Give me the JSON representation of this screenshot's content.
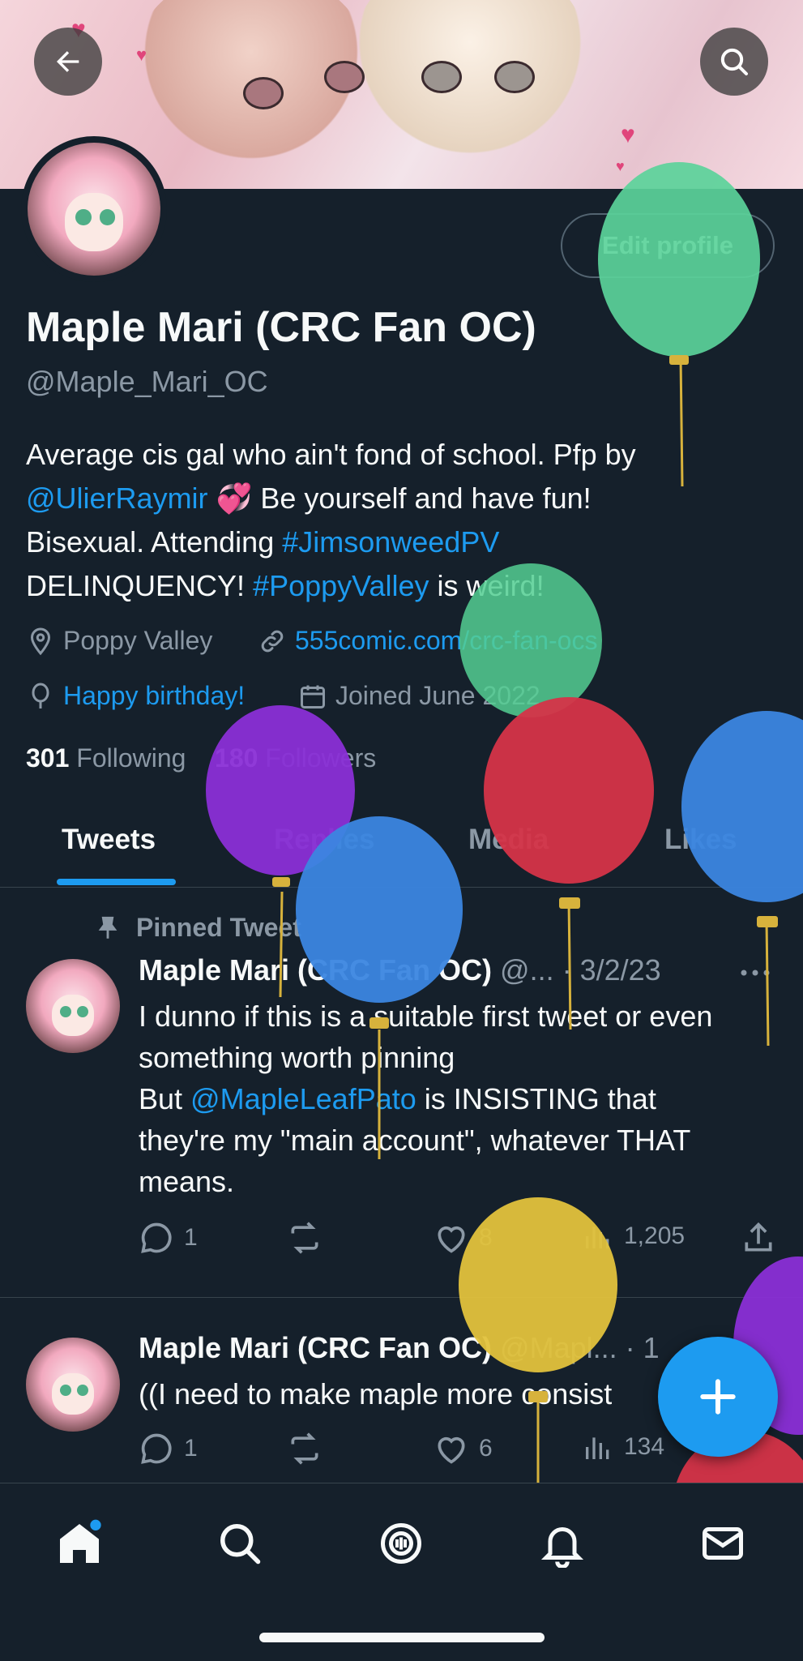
{
  "header": {
    "back_icon": "arrow-left-icon",
    "search_icon": "search-icon"
  },
  "profile": {
    "edit_label": "Edit profile",
    "name": "Maple Mari (CRC Fan OC)",
    "handle": "@Maple_Mari_OC",
    "bio": {
      "line1": "Average cis gal who ain't fond of school. Pfp by",
      "mention": "@UlierRaymir",
      "emoji": "💞",
      "line2_rest": " Be yourself and have fun!",
      "line3_pre": "Bisexual. Attending ",
      "hashtag1": "#JimsonweedPV",
      "line4_pre": "DELINQUENCY! ",
      "hashtag2": "#PoppyValley",
      "line4_post": " is weird!"
    },
    "location": "Poppy Valley",
    "website": "555comic.com/crc-fan-ocs",
    "birthday": "Happy birthday!",
    "joined": "Joined June 2022",
    "following_count": "301",
    "following_label": "Following",
    "followers_count": "180",
    "followers_label": "Followers"
  },
  "tabs": [
    "Tweets",
    "Replies",
    "Media",
    "Likes"
  ],
  "tweets": [
    {
      "pinned_label": "Pinned Tweet",
      "name": "Maple Mari (CRC Fan OC)",
      "handle": "@...",
      "date": "· 3/2/23",
      "text_line1": "I dunno if this is a suitable first tweet or even",
      "text_line2": "something worth pinning",
      "text_line3_pre": "But ",
      "text_mention": "@MapleLeafPato",
      "text_line3_post": " is INSISTING that",
      "text_line4": "they're my \"main account\", whatever THAT",
      "text_line5": "means.",
      "replies": "1",
      "retweets": "",
      "likes": "8",
      "views": "1,205"
    },
    {
      "name": "Maple Mari (CRC Fan OC)",
      "handle": "@Mapl...",
      "date": "· 1",
      "text_line1": "((I need to make maple more consist",
      "replies": "1",
      "retweets": "",
      "likes": "6",
      "views": "134"
    }
  ],
  "fab_icon": "plus-icon",
  "bottom_nav": [
    "home-icon",
    "search-icon",
    "spaces-icon",
    "bell-icon",
    "mail-icon"
  ],
  "colors": {
    "background": "#15202b",
    "accent": "#1d9bf0",
    "muted": "#8b98a5",
    "text": "#f7f9f9"
  }
}
